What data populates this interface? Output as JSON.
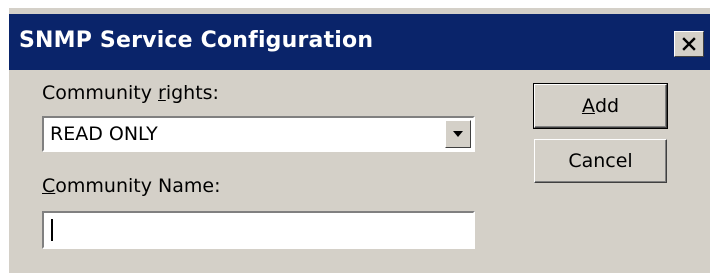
{
  "window": {
    "title": "SNMP Service Configuration",
    "close_glyph": "✕"
  },
  "rights": {
    "label_prefix": "Community ",
    "label_accel": "r",
    "label_suffix": "ights:",
    "selected": "READ ONLY"
  },
  "name": {
    "label_accel": "C",
    "label_suffix": "ommunity Name:",
    "value": ""
  },
  "buttons": {
    "add_accel": "A",
    "add_suffix": "dd",
    "cancel": "Cancel"
  },
  "colors": {
    "titlebar": "#0a246a",
    "face": "#d4d0c8"
  },
  "icons": {
    "close": "close-icon",
    "dropdown": "dropdown-arrow-icon"
  }
}
